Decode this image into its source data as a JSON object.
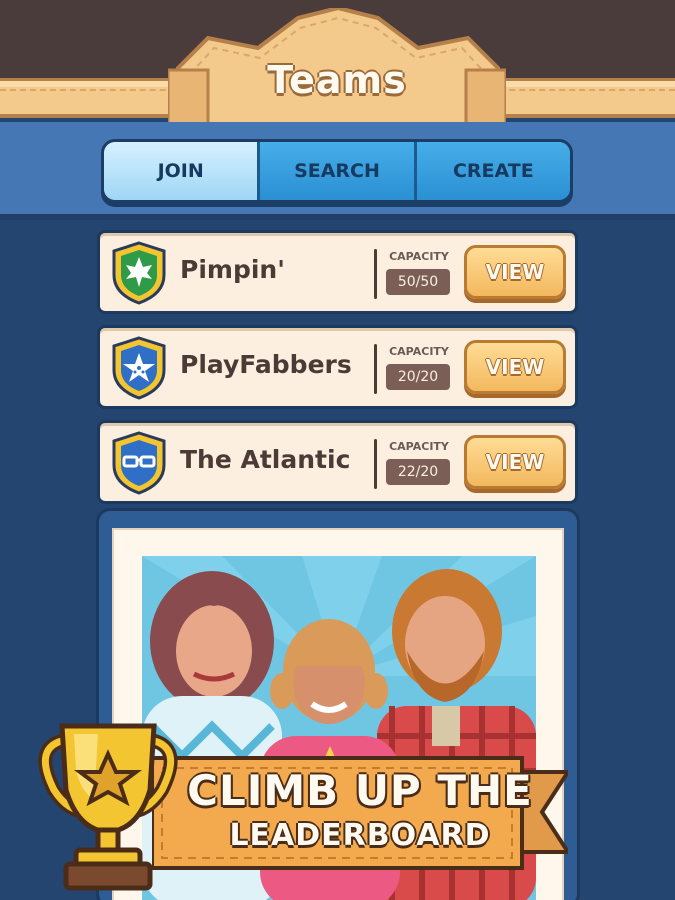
{
  "header": {
    "title": "Teams"
  },
  "tabs": [
    {
      "label": "JOIN",
      "active": true
    },
    {
      "label": "SEARCH",
      "active": false
    },
    {
      "label": "CREATE",
      "active": false
    }
  ],
  "teams": [
    {
      "name": "Pimpin'",
      "capacity_label": "CAPACITY",
      "capacity": "50/50",
      "view_label": "VIEW",
      "emblem": "leaf-icon",
      "emblem_color": "#2f9a47"
    },
    {
      "name": "PlayFabbers",
      "capacity_label": "CAPACITY",
      "capacity": "20/20",
      "view_label": "VIEW",
      "emblem": "star-icon",
      "emblem_color": "#2f6fc6"
    },
    {
      "name": "The Atlantic",
      "capacity_label": "CAPACITY",
      "capacity": "22/20",
      "view_label": "VIEW",
      "emblem": "glasses-icon",
      "emblem_color": "#2f6fc6"
    }
  ],
  "promo": {
    "line1": "CLIMB UP THE",
    "line2": "LEADERBOARD",
    "icon": "trophy-icon"
  },
  "colors": {
    "accent_orange": "#f3b85e",
    "tab_blue": "#2f95d9",
    "background_navy": "#24456f",
    "shield_gold": "#f2c531"
  }
}
